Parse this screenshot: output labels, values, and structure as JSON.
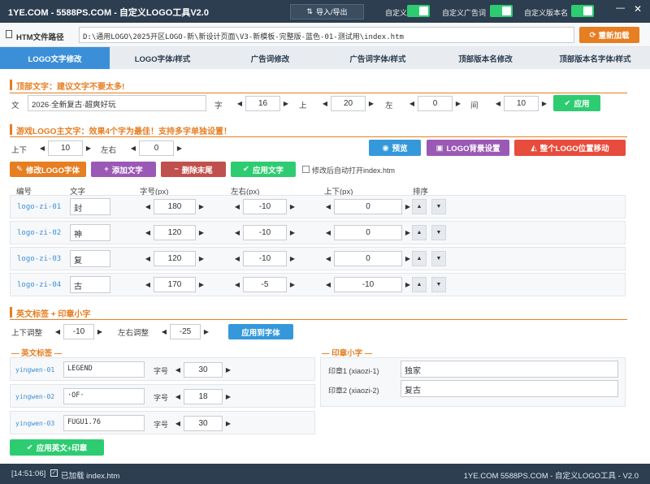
{
  "titlebar": {
    "title": "1YE.COM - 5588PS.COM - 自定义LOGO工具V2.0",
    "import_export": "导入/导出",
    "toggles": [
      {
        "label": "自定义LOGO",
        "on": true
      },
      {
        "label": "自定义广告词",
        "on": true
      },
      {
        "label": "自定义版本名",
        "on": true
      }
    ]
  },
  "path": {
    "label": "HTM文件路径",
    "value": "D:\\通用LOGO\\2025开区LOGO-新\\新设计页面\\V3-新模板-完整版-蓝色-01-测试用\\index.htm",
    "reload": "重新加载"
  },
  "tabs": [
    "LOGO文字修改",
    "LOGO字体/样式",
    "广告词修改",
    "广告词字体/样式",
    "顶部版本名修改",
    "顶部版本名字体/样式"
  ],
  "top_text": {
    "heading": "顶部文字：建议文字不要太多!",
    "text_label": "文",
    "text_value": "2026·全新复古·超爽好玩",
    "size_label": "字",
    "size": "16",
    "top_label": "上",
    "top": "20",
    "left_label": "左",
    "left": "0",
    "spacing_label": "间",
    "spacing": "10",
    "apply": "应用"
  },
  "logo_text": {
    "heading": "游戏LOGO主文字：效果4个字为最佳！支持多字单独设置！",
    "ud_label": "上下",
    "ud": "10",
    "lr_label": "左右",
    "lr": "0",
    "preview": "预览",
    "bg_setting": "LOGO背景设置",
    "move_all": "整个LOGO位置移动",
    "edit_font": "修改LOGO字体",
    "add_text": "添加文字",
    "delete_last": "删除末尾",
    "apply_text": "应用文字",
    "auto_open": "修改后自动打开index.htm",
    "columns": [
      "编号",
      "文字",
      "字号(px)",
      "左右(px)",
      "上下(px)",
      "排序"
    ],
    "rows": [
      {
        "id": "logo-zi-01",
        "char": "封",
        "size": "180",
        "lr": "-10",
        "ud": "0"
      },
      {
        "id": "logo-zi-02",
        "char": "神",
        "size": "120",
        "lr": "-10",
        "ud": "0"
      },
      {
        "id": "logo-zi-03",
        "char": "复",
        "size": "120",
        "lr": "-10",
        "ud": "0"
      },
      {
        "id": "logo-zi-04",
        "char": "古",
        "size": "170",
        "lr": "-5",
        "ud": "-10"
      }
    ]
  },
  "en_seal": {
    "heading": "英文标签 + 印章小字",
    "ud_label": "上下调整",
    "ud": "-10",
    "lr_label": "左右调整",
    "lr": "-25",
    "apply_font": "应用到字体",
    "en_title": "英文标签",
    "size_label": "字号",
    "en_rows": [
      {
        "id": "yingwen-01",
        "text": "LEGEND",
        "size": "30"
      },
      {
        "id": "yingwen-02",
        "text": "·OF·",
        "size": "18"
      },
      {
        "id": "yingwen-03",
        "text": "FUGU1.76",
        "size": "30"
      }
    ],
    "seal_title": "印章小字",
    "seals": [
      {
        "label": "印章1 (xiaozi-1)",
        "value": "独家"
      },
      {
        "label": "印章2 (xiaozi-2)",
        "value": "复古"
      }
    ],
    "apply_en_seal": "应用英文+印章"
  },
  "status": {
    "time": "[14:51:06]",
    "message": "已加载 index.htm",
    "right": "1YE.COM 5588PS.COM - 自定义LOGO工具 - V2.0"
  }
}
